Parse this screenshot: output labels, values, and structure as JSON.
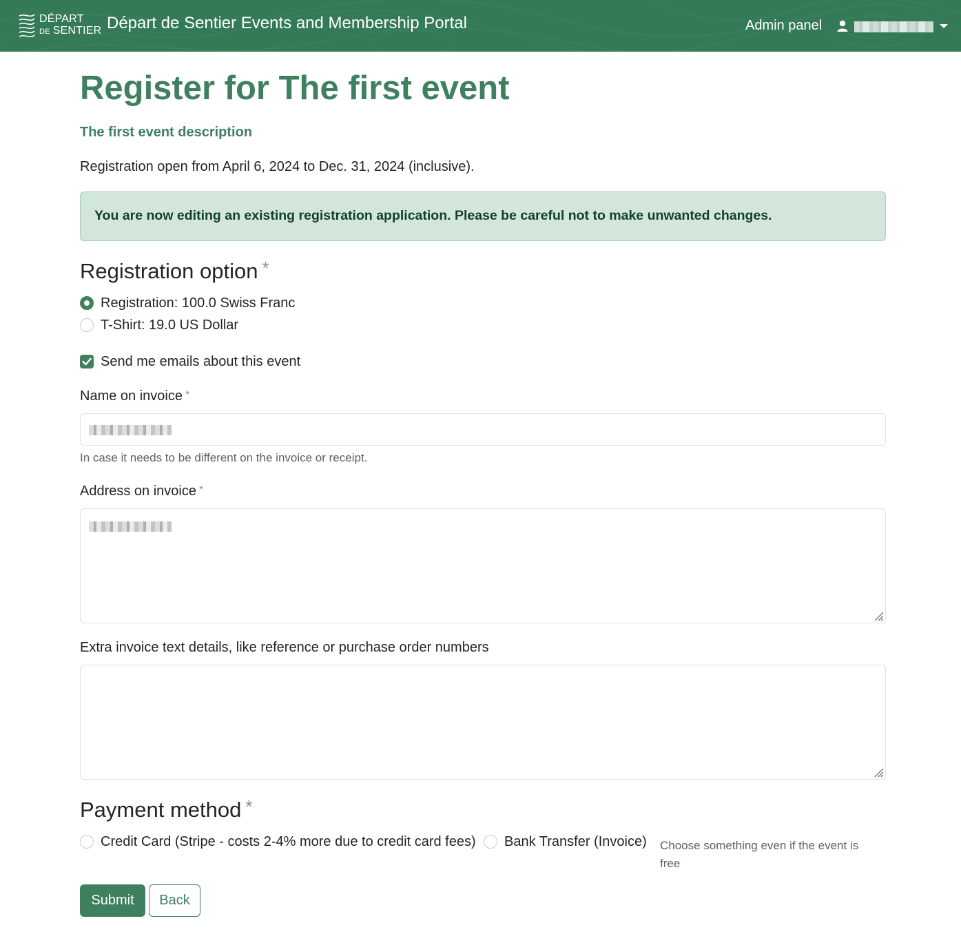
{
  "navbar": {
    "brand_line1": "DÉPART",
    "brand_line2_prefix": "DE",
    "brand_line2": "SENTIER",
    "portal_title": "Départ de Sentier Events and Membership Portal",
    "admin_link": "Admin panel",
    "user_icon": "user-icon",
    "dropdown_icon": "caret-down-icon"
  },
  "page": {
    "title": "Register for The first event",
    "event_description": "The first event description",
    "registration_window": "Registration open from April 6, 2024 to Dec. 31, 2024 (inclusive).",
    "alert": "You are now editing an existing registration application. Please be careful not to make unwanted changes."
  },
  "registration_option": {
    "heading": "Registration option",
    "required_mark": "*",
    "options": [
      {
        "label": "Registration: 100.0 Swiss Franc",
        "selected": true
      },
      {
        "label": "T-Shirt: 19.0 US Dollar",
        "selected": false
      }
    ]
  },
  "emails_opt_in": {
    "label": "Send me emails about this event",
    "checked": true
  },
  "name_on_invoice": {
    "label": "Name on invoice",
    "required_mark": "*",
    "help": "In case it needs to be different on the invoice or receipt."
  },
  "address_on_invoice": {
    "label": "Address on invoice",
    "required_mark": "*"
  },
  "extra_invoice_text": {
    "label": "Extra invoice text details, like reference or purchase order numbers",
    "value": ""
  },
  "payment_method": {
    "heading": "Payment method",
    "required_mark": "*",
    "options": [
      {
        "label": "Credit Card (Stripe - costs 2-4% more due to credit card fees)",
        "selected": false
      },
      {
        "label": "Bank Transfer (Invoice)",
        "selected": false
      }
    ],
    "help_line1": "Choose something even if the event is",
    "help_line2": "free"
  },
  "actions": {
    "submit": "Submit",
    "back": "Back"
  },
  "colors": {
    "navbar_bg": "#347a57",
    "accent": "#3f805f",
    "alert_bg": "#d3e6dc",
    "alert_text": "#14402b"
  }
}
